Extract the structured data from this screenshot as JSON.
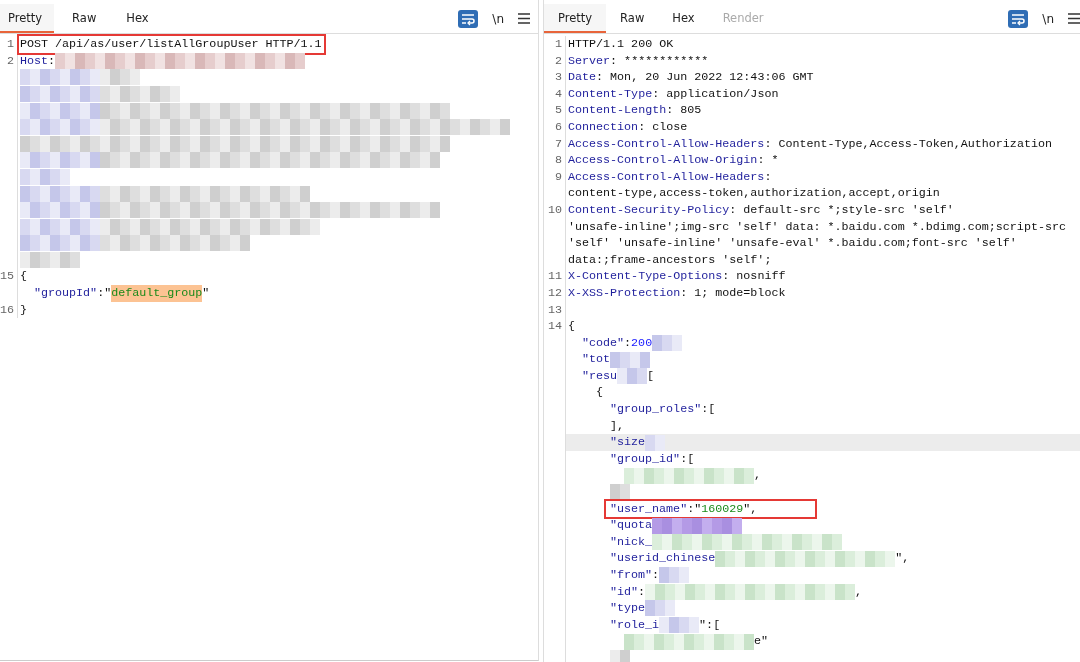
{
  "panels": [
    {
      "tabs": [
        {
          "label": "Pretty",
          "selected": true,
          "disabled": false
        },
        {
          "label": "Raw",
          "selected": false,
          "disabled": false
        },
        {
          "label": "Hex",
          "selected": false,
          "disabled": false
        }
      ],
      "newline_toggle": "\\n",
      "lines": [
        {
          "number": "1",
          "boxed": true,
          "segments": [
            {
              "kind": "text",
              "text": "POST /api/as/user/listAllGroupUser HTTP/1.1"
            }
          ]
        },
        {
          "number": "2",
          "boxed": false,
          "segments": [
            {
              "kind": "key",
              "text": "Host"
            },
            {
              "kind": "text",
              "text": ":"
            },
            {
              "kind": "blur"
            }
          ]
        },
        {
          "boxed": false,
          "segments": [
            {
              "kind": "blur"
            },
            {
              "kind": "blur"
            }
          ]
        },
        {
          "boxed": false,
          "segments": [
            {
              "kind": "blur"
            },
            {
              "kind": "blur"
            }
          ]
        },
        {
          "boxed": false,
          "segments": [
            {
              "kind": "blur"
            },
            {
              "kind": "blur"
            }
          ]
        },
        {
          "boxed": false,
          "segments": [
            {
              "kind": "blur"
            },
            {
              "kind": "blur"
            }
          ]
        },
        {
          "boxed": false,
          "segments": [
            {
              "kind": "blur"
            }
          ]
        },
        {
          "boxed": false,
          "segments": [
            {
              "kind": "blur"
            },
            {
              "kind": "blur"
            }
          ]
        },
        {
          "boxed": false,
          "segments": [
            {
              "kind": "blur"
            }
          ]
        },
        {
          "boxed": false,
          "segments": [
            {
              "kind": "blur"
            },
            {
              "kind": "blur"
            }
          ]
        },
        {
          "boxed": false,
          "segments": [
            {
              "kind": "blur"
            },
            {
              "kind": "blur"
            }
          ]
        },
        {
          "boxed": false,
          "segments": [
            {
              "kind": "blur"
            },
            {
              "kind": "blur"
            }
          ]
        },
        {
          "boxed": false,
          "segments": [
            {
              "kind": "blur"
            },
            {
              "kind": "blur"
            }
          ]
        },
        {
          "boxed": false,
          "segments": [
            {
              "kind": "blur"
            }
          ]
        },
        {
          "number": "15",
          "boxed": false,
          "segments": [
            {
              "kind": "text",
              "text": "{"
            }
          ]
        },
        {
          "boxed": false,
          "segments": [
            {
              "kind": "key",
              "text": "  \"groupId\""
            },
            {
              "kind": "text",
              "text": ":\""
            },
            {
              "kind": "match",
              "text": "default_group"
            },
            {
              "kind": "text",
              "text": "\""
            }
          ]
        },
        {
          "number": "16",
          "boxed": false,
          "segments": [
            {
              "kind": "text",
              "text": "}"
            }
          ]
        }
      ]
    },
    {
      "tabs": [
        {
          "label": "Pretty",
          "selected": true,
          "disabled": false
        },
        {
          "label": "Raw",
          "selected": false,
          "disabled": false
        },
        {
          "label": "Hex",
          "selected": false,
          "disabled": false
        },
        {
          "label": "Render",
          "selected": false,
          "disabled": true
        }
      ],
      "newline_toggle": "\\n",
      "lines": [
        {
          "number": "1",
          "boxed": false,
          "segments": [
            {
              "kind": "text",
              "text": "HTTP/1.1 200 OK"
            }
          ]
        },
        {
          "number": "2",
          "boxed": false,
          "segments": [
            {
              "kind": "key",
              "text": "Server"
            },
            {
              "kind": "text",
              "text": ": ************"
            }
          ]
        },
        {
          "number": "3",
          "boxed": false,
          "segments": [
            {
              "kind": "key",
              "text": "Date"
            },
            {
              "kind": "text",
              "text": ": Mon, 20 Jun 2022 12:43:06 GMT"
            }
          ]
        },
        {
          "number": "4",
          "boxed": false,
          "segments": [
            {
              "kind": "key",
              "text": "Content-Type"
            },
            {
              "kind": "text",
              "text": ": application/Json"
            }
          ]
        },
        {
          "number": "5",
          "boxed": false,
          "segments": [
            {
              "kind": "key",
              "text": "Content-Length"
            },
            {
              "kind": "text",
              "text": ": 805"
            }
          ]
        },
        {
          "number": "6",
          "boxed": false,
          "segments": [
            {
              "kind": "key",
              "text": "Connection"
            },
            {
              "kind": "text",
              "text": ": close"
            }
          ]
        },
        {
          "number": "7",
          "boxed": false,
          "segments": [
            {
              "kind": "key",
              "text": "Access-Control-Allow-Headers"
            },
            {
              "kind": "text",
              "text": ": Content-Type,Access-Token,Authorization"
            }
          ]
        },
        {
          "number": "8",
          "boxed": false,
          "segments": [
            {
              "kind": "key",
              "text": "Access-Control-Allow-Origin"
            },
            {
              "kind": "text",
              "text": ": *"
            }
          ]
        },
        {
          "number": "9",
          "boxed": false,
          "segments": [
            {
              "kind": "key",
              "text": "Access-Control-Allow-Headers"
            },
            {
              "kind": "text",
              "text": ":"
            }
          ]
        },
        {
          "boxed": false,
          "segments": [
            {
              "kind": "text",
              "text": "content-type,access-token,authorization,accept,origin"
            }
          ]
        },
        {
          "number": "10",
          "boxed": false,
          "segments": [
            {
              "kind": "key",
              "text": "Content-Security-Policy"
            },
            {
              "kind": "text",
              "text": ": default-src *;style-src 'self'"
            }
          ]
        },
        {
          "boxed": false,
          "segments": [
            {
              "kind": "text",
              "text": "'unsafe-inline';img-src 'self' data: *.baidu.com *.bdimg.com;script-src"
            }
          ]
        },
        {
          "boxed": false,
          "segments": [
            {
              "kind": "text",
              "text": "'self' 'unsafe-inline' 'unsafe-eval' *.baidu.com;font-src 'self'"
            }
          ]
        },
        {
          "boxed": false,
          "segments": [
            {
              "kind": "text",
              "text": "data:;frame-ancestors 'self';"
            }
          ]
        },
        {
          "number": "11",
          "boxed": false,
          "segments": [
            {
              "kind": "key",
              "text": "X-Content-Type-Options"
            },
            {
              "kind": "text",
              "text": ": nosniff"
            }
          ]
        },
        {
          "number": "12",
          "boxed": false,
          "segments": [
            {
              "kind": "key",
              "text": "X-XSS-Protection"
            },
            {
              "kind": "text",
              "text": ": 1; mode=block"
            }
          ]
        },
        {
          "number": "13",
          "boxed": false
        },
        {
          "number": "14",
          "boxed": false,
          "segments": [
            {
              "kind": "text",
              "text": "{"
            }
          ]
        },
        {
          "boxed": false,
          "segments": [
            {
              "kind": "key",
              "text": "  \"code\""
            },
            {
              "kind": "text",
              "text": ":"
            },
            {
              "kind": "num",
              "text": "200"
            },
            {
              "kind": "blur"
            }
          ]
        },
        {
          "boxed": false,
          "segments": [
            {
              "kind": "key",
              "text": "  \"tot"
            },
            {
              "kind": "blur"
            }
          ]
        },
        {
          "boxed": false,
          "segments": [
            {
              "kind": "key",
              "text": "  \"resu"
            },
            {
              "kind": "blur"
            },
            {
              "kind": "text",
              "text": "["
            }
          ]
        },
        {
          "boxed": false,
          "segments": [
            {
              "kind": "text",
              "text": "    {"
            }
          ]
        },
        {
          "boxed": false,
          "segments": [
            {
              "kind": "key",
              "text": "      \"group_roles\""
            },
            {
              "kind": "text",
              "text": ":["
            }
          ]
        },
        {
          "boxed": false,
          "segments": [
            {
              "kind": "text",
              "text": "      ],"
            }
          ]
        },
        {
          "boxed": false,
          "current": true,
          "segments": [
            {
              "kind": "key",
              "text": "      \"size"
            },
            {
              "kind": "blur"
            }
          ]
        },
        {
          "boxed": false,
          "segments": [
            {
              "kind": "key",
              "text": "      \"group_id\""
            },
            {
              "kind": "text",
              "text": ":["
            }
          ]
        },
        {
          "boxed": false,
          "segments": [
            {
              "kind": "blur"
            },
            {
              "kind": "text",
              "text": ","
            }
          ]
        },
        {
          "boxed": false,
          "segments": [
            {
              "kind": "blur"
            }
          ]
        },
        {
          "boxed": true,
          "segments": [
            {
              "kind": "key",
              "text": "      \"user_name\""
            },
            {
              "kind": "text",
              "text": ":\""
            },
            {
              "kind": "str",
              "text": "160029"
            },
            {
              "kind": "text",
              "text": "\","
            }
          ]
        },
        {
          "boxed": false,
          "segments": [
            {
              "kind": "key",
              "text": "      \"quota"
            },
            {
              "kind": "blur"
            }
          ]
        },
        {
          "boxed": false,
          "segments": [
            {
              "kind": "key",
              "text": "      \"nick_"
            },
            {
              "kind": "blur"
            }
          ]
        },
        {
          "boxed": false,
          "segments": [
            {
              "kind": "key",
              "text": "      \"userid_chinese"
            },
            {
              "kind": "blur"
            },
            {
              "kind": "text",
              "text": "\","
            }
          ]
        },
        {
          "boxed": false,
          "segments": [
            {
              "kind": "key",
              "text": "      \"from\""
            },
            {
              "kind": "text",
              "text": ":"
            },
            {
              "kind": "blur"
            }
          ]
        },
        {
          "boxed": false,
          "segments": [
            {
              "kind": "key",
              "text": "      \"id\""
            },
            {
              "kind": "text",
              "text": ":"
            },
            {
              "kind": "blur"
            },
            {
              "kind": "text",
              "text": ","
            }
          ]
        },
        {
          "boxed": false,
          "segments": [
            {
              "kind": "key",
              "text": "      \"type"
            },
            {
              "kind": "blur"
            }
          ]
        },
        {
          "boxed": false,
          "segments": [
            {
              "kind": "key",
              "text": "      \"role_i"
            },
            {
              "kind": "blur"
            },
            {
              "kind": "text",
              "text": "\":["
            }
          ]
        },
        {
          "boxed": false,
          "segments": [
            {
              "kind": "blur"
            },
            {
              "kind": "text",
              "text": "e\""
            }
          ]
        },
        {
          "boxed": false,
          "segments": [
            {
              "kind": "blur"
            }
          ]
        }
      ]
    }
  ]
}
